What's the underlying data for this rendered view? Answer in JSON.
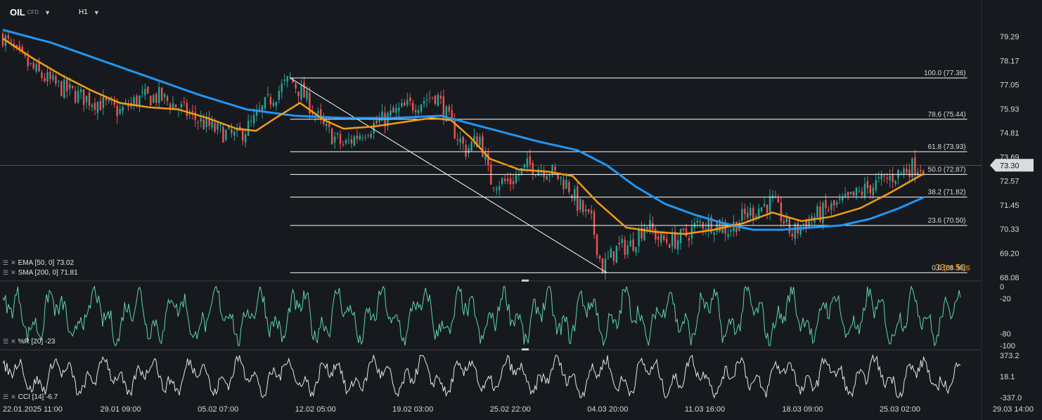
{
  "header": {
    "symbol": "OIL",
    "instrument_type": "CFD",
    "timeframe": "H1"
  },
  "indicators": {
    "ema": "EMA [50, 0] 73.02",
    "sma": "SMA [200, 0] 71.81",
    "williams": "%R [20] -23",
    "cci": "CCI [14] -6.7"
  },
  "countdown": "33m 50s",
  "icons": [
    "settings-icon",
    "close-icon",
    "dropdown-caret-icon"
  ],
  "colors": {
    "background": "#161a1e",
    "up_candle": "#26a69a",
    "down_candle": "#ef5350",
    "ema": "#f39c12",
    "sma": "#2196f3",
    "williams_line": "#5fd3b0",
    "cci_line": "#e6e6e6",
    "fib_line": "#ffffff",
    "price_label_bg": "#d9dcdf"
  },
  "chart_data": {
    "type": "candlestick",
    "x_ticks": [
      "22.01.2025  11:00",
      "29.01  09:00",
      "05.02  07:00",
      "12.02  05:00",
      "19.02  03:00",
      "25.02  22:00",
      "04.03  20:00",
      "11.03  16:00",
      "18.03  09:00",
      "25.03  02:00",
      "29.03  14:00"
    ],
    "x_range": [
      0,
      10
    ],
    "x_tick_positions": [
      0,
      1,
      2,
      3,
      4,
      5,
      6,
      7,
      8,
      9,
      10
    ],
    "price_ticks": [
      "79.29",
      "78.17",
      "77.05",
      "75.93",
      "74.81",
      "73.69",
      "72.57",
      "71.45",
      "70.33",
      "69.20",
      "68.08"
    ],
    "y_range": [
      68.08,
      79.29
    ],
    "last_price": "73.30",
    "close_path": [
      [
        0,
        79.3
      ],
      [
        0.15,
        78.4
      ],
      [
        0.35,
        77.6
      ],
      [
        0.55,
        77.0
      ],
      [
        0.8,
        76.5
      ],
      [
        1.0,
        76.2
      ],
      [
        1.2,
        75.8
      ],
      [
        1.4,
        76.4
      ],
      [
        1.6,
        76.5
      ],
      [
        1.8,
        76.0
      ],
      [
        2.0,
        75.4
      ],
      [
        2.2,
        74.9
      ],
      [
        2.4,
        74.6
      ],
      [
        2.55,
        75.2
      ],
      [
        2.75,
        76.4
      ],
      [
        2.95,
        77.3
      ],
      [
        3.1,
        76.5
      ],
      [
        3.3,
        75.0
      ],
      [
        3.5,
        74.2
      ],
      [
        3.7,
        74.9
      ],
      [
        3.9,
        75.4
      ],
      [
        4.1,
        75.9
      ],
      [
        4.3,
        76.3
      ],
      [
        4.45,
        76.6
      ],
      [
        4.6,
        75.2
      ],
      [
        4.75,
        74.0
      ],
      [
        4.9,
        74.6
      ],
      [
        5.0,
        72.6
      ],
      [
        5.2,
        72.5
      ],
      [
        5.4,
        73.3
      ],
      [
        5.6,
        73.1
      ],
      [
        5.8,
        72.4
      ],
      [
        5.9,
        71.5
      ],
      [
        6.05,
        70.6
      ],
      [
        6.15,
        68.5
      ],
      [
        6.3,
        69.4
      ],
      [
        6.45,
        69.6
      ],
      [
        6.6,
        70.6
      ],
      [
        6.75,
        69.8
      ],
      [
        6.9,
        69.8
      ],
      [
        7.0,
        70.0
      ],
      [
        7.15,
        70.6
      ],
      [
        7.3,
        70.6
      ],
      [
        7.45,
        70.3
      ],
      [
        7.6,
        70.9
      ],
      [
        7.75,
        71.3
      ],
      [
        7.9,
        71.6
      ],
      [
        8.1,
        70.1
      ],
      [
        8.25,
        70.7
      ],
      [
        8.45,
        71.2
      ],
      [
        8.65,
        71.6
      ],
      [
        8.9,
        72.3
      ],
      [
        9.1,
        72.7
      ],
      [
        9.3,
        73.2
      ],
      [
        9.45,
        73.3
      ]
    ],
    "fibonacci": {
      "start_x": 2.95,
      "end_x": 9.9,
      "levels": [
        {
          "label": "100.0 (77.36)",
          "price": 77.36
        },
        {
          "label": "78.6 (75.44)",
          "price": 75.44
        },
        {
          "label": "61.8 (73.93)",
          "price": 73.93
        },
        {
          "label": "50.0 (72.87)",
          "price": 72.87
        },
        {
          "label": "38.2 (71.82)",
          "price": 71.82
        },
        {
          "label": "23.6 (70.50)",
          "price": 70.5
        },
        {
          "label": "0.0 (68.30)",
          "price": 68.3
        }
      ],
      "trend_from": [
        2.95,
        77.36
      ],
      "trend_to": [
        6.2,
        68.3
      ]
    },
    "ema_label": "EMA [50, 0]",
    "ema_last": 73.02,
    "sma_label": "SMA [200, 0]",
    "sma_last": 71.81,
    "ema_path": [
      [
        0,
        79.2
      ],
      [
        0.3,
        78.3
      ],
      [
        0.6,
        77.5
      ],
      [
        0.9,
        76.8
      ],
      [
        1.2,
        76.2
      ],
      [
        1.5,
        76.0
      ],
      [
        1.8,
        75.9
      ],
      [
        2.1,
        75.5
      ],
      [
        2.4,
        75.0
      ],
      [
        2.6,
        74.9
      ],
      [
        2.8,
        75.5
      ],
      [
        3.05,
        76.2
      ],
      [
        3.3,
        75.4
      ],
      [
        3.5,
        75.0
      ],
      [
        3.8,
        75.1
      ],
      [
        4.1,
        75.3
      ],
      [
        4.4,
        75.5
      ],
      [
        4.6,
        75.4
      ],
      [
        4.8,
        74.6
      ],
      [
        5.0,
        73.6
      ],
      [
        5.3,
        73.1
      ],
      [
        5.6,
        73.0
      ],
      [
        5.85,
        72.8
      ],
      [
        6.1,
        71.6
      ],
      [
        6.4,
        70.4
      ],
      [
        6.7,
        70.2
      ],
      [
        7.0,
        70.1
      ],
      [
        7.3,
        70.3
      ],
      [
        7.6,
        70.6
      ],
      [
        7.9,
        71.1
      ],
      [
        8.2,
        70.7
      ],
      [
        8.5,
        70.9
      ],
      [
        8.8,
        71.3
      ],
      [
        9.1,
        72.0
      ],
      [
        9.45,
        72.9
      ]
    ],
    "sma_path": [
      [
        0,
        79.6
      ],
      [
        0.5,
        79.0
      ],
      [
        1.0,
        78.2
      ],
      [
        1.5,
        77.4
      ],
      [
        2.0,
        76.6
      ],
      [
        2.5,
        75.9
      ],
      [
        3.0,
        75.6
      ],
      [
        3.5,
        75.5
      ],
      [
        4.0,
        75.5
      ],
      [
        4.5,
        75.6
      ],
      [
        5.0,
        75.0
      ],
      [
        5.5,
        74.4
      ],
      [
        5.9,
        74.0
      ],
      [
        6.2,
        73.3
      ],
      [
        6.5,
        72.3
      ],
      [
        6.8,
        71.5
      ],
      [
        7.1,
        71.0
      ],
      [
        7.4,
        70.6
      ],
      [
        7.7,
        70.3
      ],
      [
        8.0,
        70.3
      ],
      [
        8.3,
        70.4
      ],
      [
        8.6,
        70.5
      ],
      [
        8.9,
        70.8
      ],
      [
        9.2,
        71.3
      ],
      [
        9.45,
        71.8
      ]
    ],
    "williams_r": {
      "label": "%R [20]",
      "last": -23,
      "y_ticks": [
        "0",
        "-20",
        "-80",
        "-100"
      ],
      "range": [
        -100,
        0
      ]
    },
    "cci": {
      "label": "CCI [14]",
      "last": -6.7,
      "y_ticks": [
        "373.2",
        "18.1",
        "-337.0"
      ],
      "range": [
        -337.0,
        373.2
      ]
    },
    "grid": false
  }
}
